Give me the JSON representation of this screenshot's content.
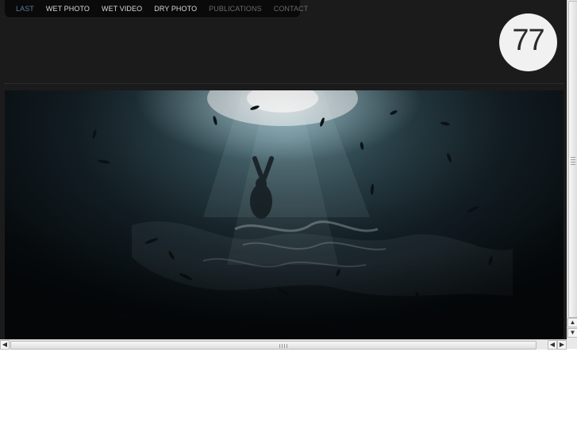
{
  "nav": {
    "items": [
      {
        "label": "LAST",
        "state": "active"
      },
      {
        "label": "WET PHOTO",
        "state": "normal"
      },
      {
        "label": "WET VIDEO",
        "state": "normal"
      },
      {
        "label": "DRY PHOTO",
        "state": "normal"
      },
      {
        "label": "PUBLICATIONS",
        "state": "dim"
      },
      {
        "label": "CONTACT",
        "state": "dim"
      }
    ]
  },
  "logo": {
    "text": "77"
  },
  "hero": {
    "icon": "underwater-freediver-photo"
  },
  "scrollbars": {
    "up_arrow": "▲",
    "down_arrow": "▼",
    "left_arrow": "◀",
    "right_arrow": "▶"
  },
  "colors": {
    "page_bg": "#1b1b1b",
    "nav_bg": "#0a0a0a",
    "nav_active": "#5a7fa0",
    "nav_text": "#d9d9d9",
    "nav_dim": "#6a6a6a",
    "logo_bg": "#f1f1f1"
  }
}
